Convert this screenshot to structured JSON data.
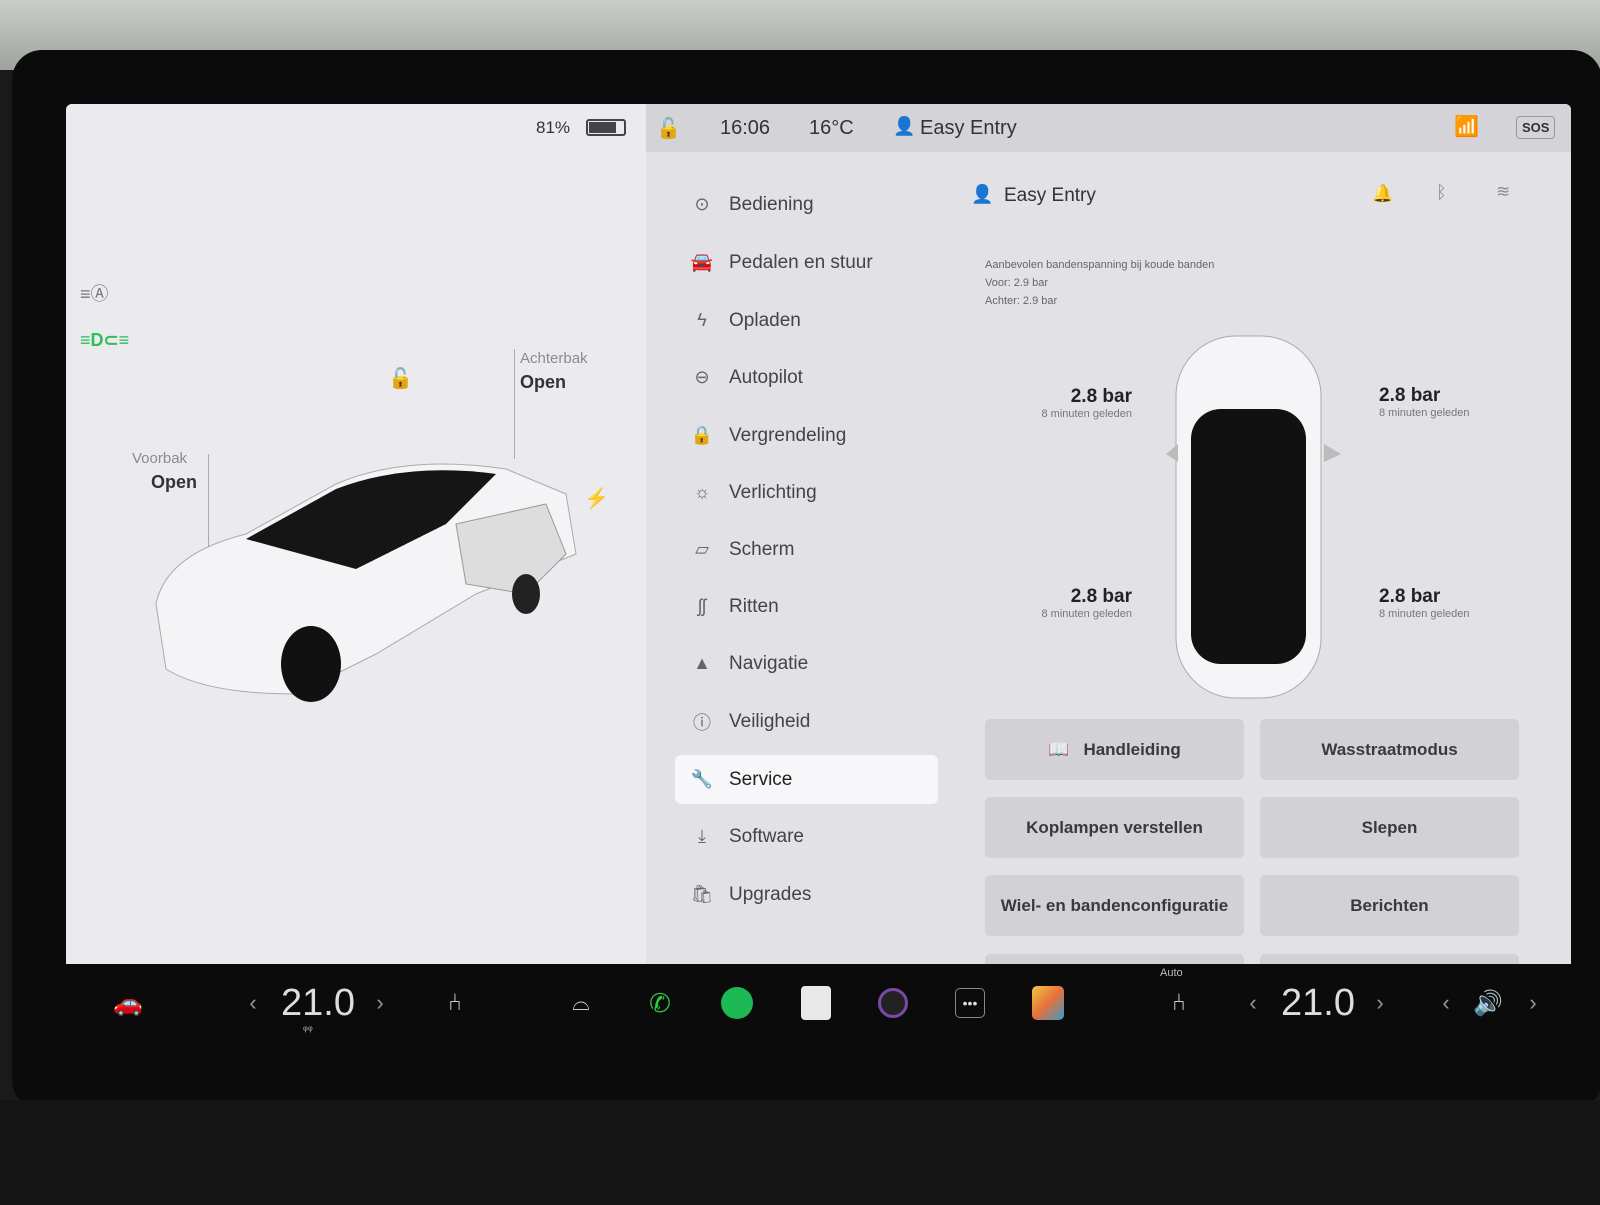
{
  "status": {
    "battery": "81%",
    "time": "16:06",
    "temperature": "16°C",
    "profile": "Easy Entry",
    "sos": "SOS"
  },
  "car_view": {
    "trunk_label": "Achterbak",
    "trunk_state": "Open",
    "frunk_label": "Voorbak",
    "frunk_state": "Open"
  },
  "menu": [
    {
      "label": "Bediening",
      "icon": "toggle-icon"
    },
    {
      "label": "Pedalen en stuur",
      "icon": "car-icon"
    },
    {
      "label": "Opladen",
      "icon": "bolt-icon"
    },
    {
      "label": "Autopilot",
      "icon": "steering-wheel-icon"
    },
    {
      "label": "Vergrendeling",
      "icon": "lock-icon"
    },
    {
      "label": "Verlichting",
      "icon": "sun-icon"
    },
    {
      "label": "Scherm",
      "icon": "display-icon"
    },
    {
      "label": "Ritten",
      "icon": "trips-icon"
    },
    {
      "label": "Navigatie",
      "icon": "navigation-icon"
    },
    {
      "label": "Veiligheid",
      "icon": "alert-icon"
    },
    {
      "label": "Service",
      "icon": "wrench-icon",
      "active": true
    },
    {
      "label": "Software",
      "icon": "download-icon"
    },
    {
      "label": "Upgrades",
      "icon": "bag-icon"
    }
  ],
  "service": {
    "profile": "Easy Entry",
    "tire_note": "Aanbevolen bandenspanning bij koude banden",
    "front": "Voor: 2.9 bar",
    "rear": "Achter: 2.9 bar",
    "tires": [
      {
        "value": "2.8 bar",
        "time": "8 minuten geleden"
      },
      {
        "value": "2.8 bar",
        "time": "8 minuten geleden"
      },
      {
        "value": "2.8 bar",
        "time": "8 minuten geleden"
      },
      {
        "value": "2.8 bar",
        "time": "8 minuten geleden"
      }
    ],
    "buttons": [
      "Handleiding",
      "Wasstraatmodus",
      "Koplampen verstellen",
      "Slepen",
      "Wiel- en bandenconfiguratie",
      "Berichten"
    ]
  },
  "taskbar": {
    "driver_temp": "21.0",
    "passenger_temp": "21.0",
    "seat_mode": "Auto"
  },
  "colors": {
    "phone": "#2ecc40",
    "spotify": "#1db954",
    "lights_green": "#2fbf5a"
  }
}
